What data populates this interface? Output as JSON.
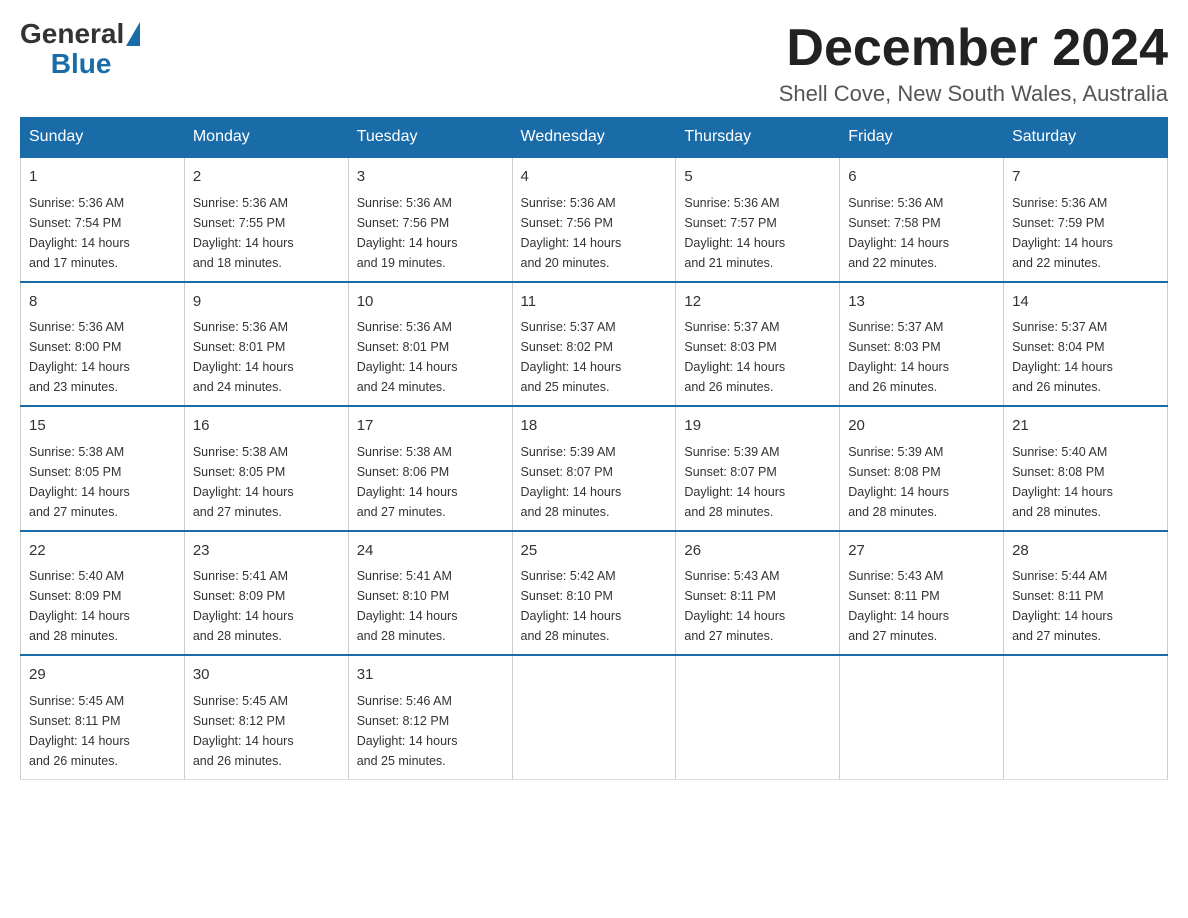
{
  "header": {
    "logo": {
      "general": "General",
      "blue": "Blue"
    },
    "title": "December 2024",
    "location": "Shell Cove, New South Wales, Australia"
  },
  "days_of_week": [
    "Sunday",
    "Monday",
    "Tuesday",
    "Wednesday",
    "Thursday",
    "Friday",
    "Saturday"
  ],
  "weeks": [
    [
      {
        "day": "1",
        "sunrise": "5:36 AM",
        "sunset": "7:54 PM",
        "daylight": "14 hours and 17 minutes."
      },
      {
        "day": "2",
        "sunrise": "5:36 AM",
        "sunset": "7:55 PM",
        "daylight": "14 hours and 18 minutes."
      },
      {
        "day": "3",
        "sunrise": "5:36 AM",
        "sunset": "7:56 PM",
        "daylight": "14 hours and 19 minutes."
      },
      {
        "day": "4",
        "sunrise": "5:36 AM",
        "sunset": "7:56 PM",
        "daylight": "14 hours and 20 minutes."
      },
      {
        "day": "5",
        "sunrise": "5:36 AM",
        "sunset": "7:57 PM",
        "daylight": "14 hours and 21 minutes."
      },
      {
        "day": "6",
        "sunrise": "5:36 AM",
        "sunset": "7:58 PM",
        "daylight": "14 hours and 22 minutes."
      },
      {
        "day": "7",
        "sunrise": "5:36 AM",
        "sunset": "7:59 PM",
        "daylight": "14 hours and 22 minutes."
      }
    ],
    [
      {
        "day": "8",
        "sunrise": "5:36 AM",
        "sunset": "8:00 PM",
        "daylight": "14 hours and 23 minutes."
      },
      {
        "day": "9",
        "sunrise": "5:36 AM",
        "sunset": "8:01 PM",
        "daylight": "14 hours and 24 minutes."
      },
      {
        "day": "10",
        "sunrise": "5:36 AM",
        "sunset": "8:01 PM",
        "daylight": "14 hours and 24 minutes."
      },
      {
        "day": "11",
        "sunrise": "5:37 AM",
        "sunset": "8:02 PM",
        "daylight": "14 hours and 25 minutes."
      },
      {
        "day": "12",
        "sunrise": "5:37 AM",
        "sunset": "8:03 PM",
        "daylight": "14 hours and 26 minutes."
      },
      {
        "day": "13",
        "sunrise": "5:37 AM",
        "sunset": "8:03 PM",
        "daylight": "14 hours and 26 minutes."
      },
      {
        "day": "14",
        "sunrise": "5:37 AM",
        "sunset": "8:04 PM",
        "daylight": "14 hours and 26 minutes."
      }
    ],
    [
      {
        "day": "15",
        "sunrise": "5:38 AM",
        "sunset": "8:05 PM",
        "daylight": "14 hours and 27 minutes."
      },
      {
        "day": "16",
        "sunrise": "5:38 AM",
        "sunset": "8:05 PM",
        "daylight": "14 hours and 27 minutes."
      },
      {
        "day": "17",
        "sunrise": "5:38 AM",
        "sunset": "8:06 PM",
        "daylight": "14 hours and 27 minutes."
      },
      {
        "day": "18",
        "sunrise": "5:39 AM",
        "sunset": "8:07 PM",
        "daylight": "14 hours and 28 minutes."
      },
      {
        "day": "19",
        "sunrise": "5:39 AM",
        "sunset": "8:07 PM",
        "daylight": "14 hours and 28 minutes."
      },
      {
        "day": "20",
        "sunrise": "5:39 AM",
        "sunset": "8:08 PM",
        "daylight": "14 hours and 28 minutes."
      },
      {
        "day": "21",
        "sunrise": "5:40 AM",
        "sunset": "8:08 PM",
        "daylight": "14 hours and 28 minutes."
      }
    ],
    [
      {
        "day": "22",
        "sunrise": "5:40 AM",
        "sunset": "8:09 PM",
        "daylight": "14 hours and 28 minutes."
      },
      {
        "day": "23",
        "sunrise": "5:41 AM",
        "sunset": "8:09 PM",
        "daylight": "14 hours and 28 minutes."
      },
      {
        "day": "24",
        "sunrise": "5:41 AM",
        "sunset": "8:10 PM",
        "daylight": "14 hours and 28 minutes."
      },
      {
        "day": "25",
        "sunrise": "5:42 AM",
        "sunset": "8:10 PM",
        "daylight": "14 hours and 28 minutes."
      },
      {
        "day": "26",
        "sunrise": "5:43 AM",
        "sunset": "8:11 PM",
        "daylight": "14 hours and 27 minutes."
      },
      {
        "day": "27",
        "sunrise": "5:43 AM",
        "sunset": "8:11 PM",
        "daylight": "14 hours and 27 minutes."
      },
      {
        "day": "28",
        "sunrise": "5:44 AM",
        "sunset": "8:11 PM",
        "daylight": "14 hours and 27 minutes."
      }
    ],
    [
      {
        "day": "29",
        "sunrise": "5:45 AM",
        "sunset": "8:11 PM",
        "daylight": "14 hours and 26 minutes."
      },
      {
        "day": "30",
        "sunrise": "5:45 AM",
        "sunset": "8:12 PM",
        "daylight": "14 hours and 26 minutes."
      },
      {
        "day": "31",
        "sunrise": "5:46 AM",
        "sunset": "8:12 PM",
        "daylight": "14 hours and 25 minutes."
      },
      null,
      null,
      null,
      null
    ]
  ],
  "labels": {
    "sunrise": "Sunrise:",
    "sunset": "Sunset:",
    "daylight": "Daylight:"
  }
}
